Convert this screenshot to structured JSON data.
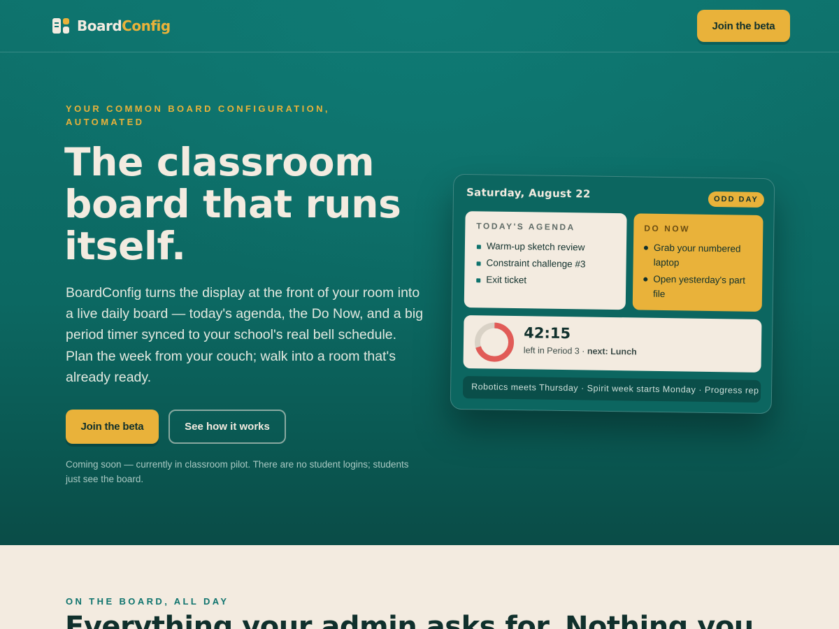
{
  "nav": {
    "logo_part1": "Board",
    "logo_part2": "Config",
    "logo_icon": "board-icon",
    "cta_label": "Join the beta"
  },
  "hero": {
    "eyebrow": "YOUR COMMON BOARD CONFIGURATION, AUTOMATED",
    "headline": "The classroom board that runs itself.",
    "lead": "BoardConfig turns the display at the front of your room into a live daily board — today's agenda, the Do Now, and a big period timer synced to your school's real bell schedule. Plan the week from your couch; walk into a room that's already ready.",
    "primary_cta": "Join the beta",
    "secondary_cta": "See how it works",
    "note": "Coming soon — currently in classroom pilot. There are no student logins; students just see the board."
  },
  "board": {
    "date": "Saturday, August 22",
    "day_badge": "ODD DAY",
    "agenda": {
      "label": "TODAY'S AGENDA",
      "items": [
        "Warm-up sketch review",
        "Constraint challenge #3",
        "Exit ticket"
      ]
    },
    "do_now": {
      "label": "DO NOW",
      "items": [
        "Grab your numbered laptop",
        "Open yesterday's part file"
      ]
    },
    "timer": {
      "time": "42:15",
      "sub_left": "left in Period 3 ·",
      "sub_next": "next: Lunch",
      "progress_fraction": 0.7
    },
    "ticker": "Robotics meets Thursday · Spirit week starts Monday · Progress rep"
  },
  "section2": {
    "eyebrow": "ON THE BOARD, ALL DAY",
    "title": "Everything your admin asks for. Nothing you"
  },
  "colors": {
    "teal": "#0e736d",
    "accent": "#e9b23a",
    "cream": "#f3ebe0",
    "timer_red": "#e15b57"
  }
}
